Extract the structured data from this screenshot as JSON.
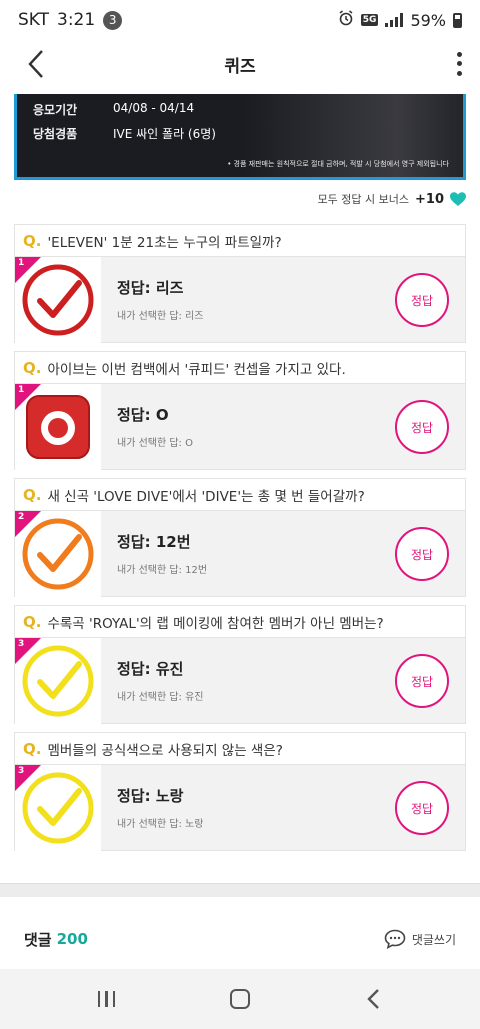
{
  "status_bar": {
    "carrier": "SKT",
    "time": "3:21",
    "notification_count": "3",
    "network": "5G",
    "battery": "59%"
  },
  "header": {
    "title": "퀴즈"
  },
  "banner": {
    "rows": [
      {
        "key": "응모기간",
        "value": "04/08 - 04/14"
      },
      {
        "key": "당첨경품",
        "value": "IVE 싸인 폴라 (6명)"
      }
    ],
    "note": "• 경품 재판매는 원칙적으로 절대 금하며, 적발 시 당첨에서 영구 제외됩니다"
  },
  "bonus": {
    "label": "모두 정답 시 보너스",
    "value": "+10",
    "icon": "heart-icon",
    "color": "#1dbfb5"
  },
  "quiz": {
    "prefix": "Q.",
    "answer_button": "정답",
    "items": [
      {
        "level": "1",
        "question": "'ELEVEN' 1분 21초는 누구의 파트일까?",
        "answer": "정답: 리즈",
        "selected": "내가 선택한 답: 리즈",
        "icon": "red-check-icon"
      },
      {
        "level": "1",
        "question": "아이브는 이번 컴백에서 '큐피드' 컨셉을 가지고 있다.",
        "answer": "정답: O",
        "selected": "내가 선택한 답: O",
        "icon": "red-o-button-icon"
      },
      {
        "level": "2",
        "question": "새 신곡 'LOVE DIVE'에서 'DIVE'는 총 몇 번 들어갈까?",
        "answer": "정답: 12번",
        "selected": "내가 선택한 답: 12번",
        "icon": "orange-check-icon"
      },
      {
        "level": "3",
        "question": "수록곡 'ROYAL'의 랩 메이킹에 참여한 멤버가 아닌 멤버는?",
        "answer": "정답: 유진",
        "selected": "내가 선택한 답: 유진",
        "icon": "yellow-check-icon"
      },
      {
        "level": "3",
        "question": "멤버들의 공식색으로 사용되지 않는 색은?",
        "answer": "정답: 노랑",
        "selected": "내가 선택한 답: 노랑",
        "icon": "yellow-check-icon"
      }
    ]
  },
  "comments": {
    "label": "댓글",
    "count": "200",
    "write_label": "댓글쓰기"
  },
  "colors": {
    "accent_pink": "#e0147c",
    "accent_teal": "#18a89c",
    "banner_border": "#1e9bd6"
  }
}
